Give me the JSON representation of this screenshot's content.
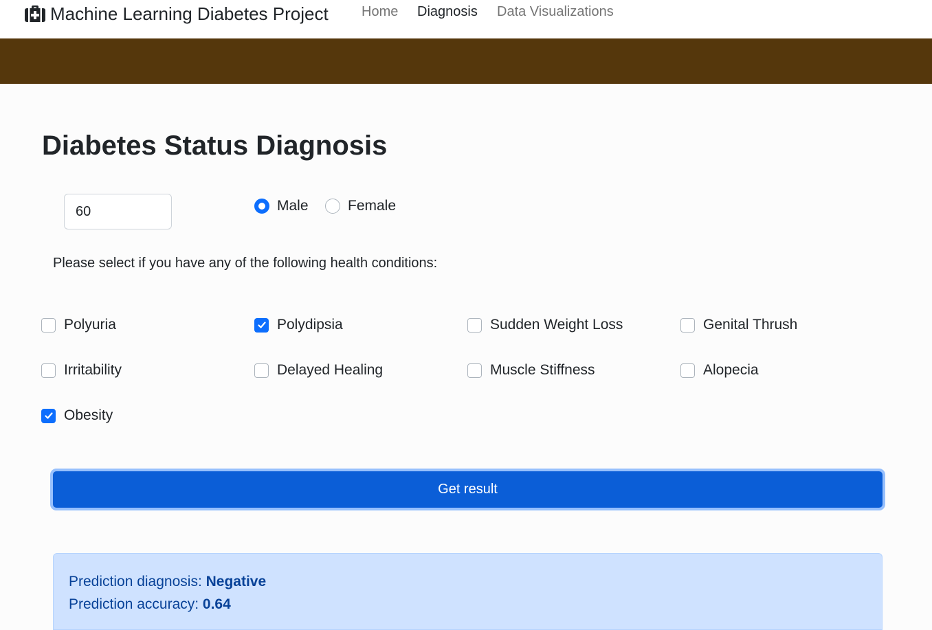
{
  "navbar": {
    "brand": "Machine Learning Diabetes Project",
    "brand_icon": "medkit-icon",
    "links": [
      "Home",
      "Diagnosis",
      "Data Visualizations"
    ],
    "active_link": "Diagnosis"
  },
  "colors": {
    "banner": "#55370c",
    "primary": "#0b5ed7",
    "alert_bg": "#cfe2ff",
    "alert_text": "#084298"
  },
  "form": {
    "title": "Diabetes Status Diagnosis",
    "age_value": "60",
    "gender_options": [
      {
        "label": "Male",
        "checked": true
      },
      {
        "label": "Female",
        "checked": false
      }
    ],
    "instructions": "Please select if you have any of the following health conditions:",
    "conditions": [
      {
        "label": "Polyuria",
        "checked": false
      },
      {
        "label": "Polydipsia",
        "checked": true
      },
      {
        "label": "Sudden Weight Loss",
        "checked": false
      },
      {
        "label": "Genital Thrush",
        "checked": false
      },
      {
        "label": "Irritability",
        "checked": false
      },
      {
        "label": "Delayed Healing",
        "checked": false
      },
      {
        "label": "Muscle Stiffness",
        "checked": false
      },
      {
        "label": "Alopecia",
        "checked": false
      },
      {
        "label": "Obesity",
        "checked": true
      }
    ],
    "submit_label": "Get result"
  },
  "result": {
    "diagnosis_label": "Prediction diagnosis: ",
    "diagnosis_value": "Negative",
    "accuracy_label": "Prediction accuracy: ",
    "accuracy_value": "0.64"
  }
}
